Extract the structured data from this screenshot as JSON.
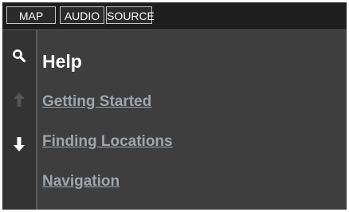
{
  "topbar": {
    "buttons": [
      {
        "label": "MAP"
      },
      {
        "label": "AUDIO"
      },
      {
        "label": "SOURCE"
      }
    ]
  },
  "sidebar": {
    "icons": [
      "search-icon",
      "scroll-up-arrow-icon",
      "scroll-down-arrow-icon"
    ]
  },
  "main": {
    "title": "Help",
    "items": [
      {
        "label": "Getting Started"
      },
      {
        "label": "Finding Locations"
      },
      {
        "label": "Navigation"
      }
    ]
  },
  "colors": {
    "background": "#3e3e3e",
    "topbar": "#1e1e1e",
    "title_text": "#ffffff",
    "link_text": "#9ea5ad",
    "disabled_arrow": "#555555"
  }
}
